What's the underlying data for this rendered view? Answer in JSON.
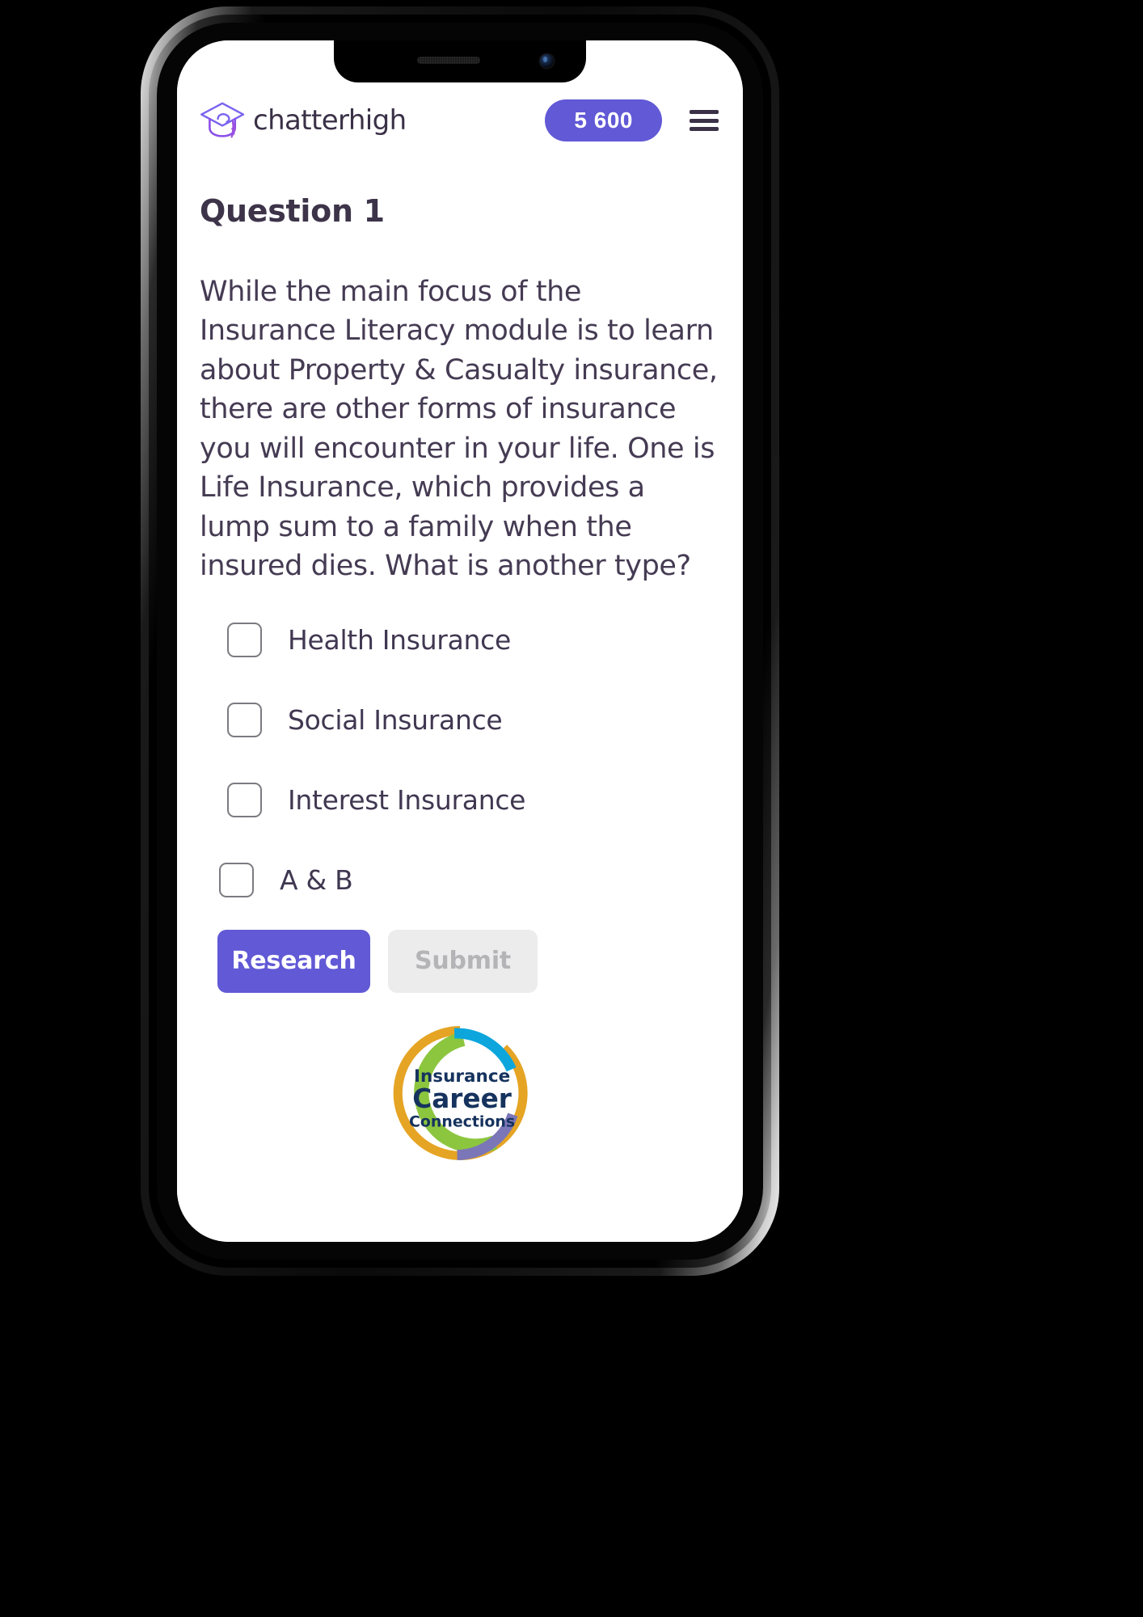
{
  "app": {
    "brand_name": "chatterhigh",
    "brand_icon": "graduation-cap-icon",
    "score": "5 600",
    "menu_icon": "hamburger-menu-icon",
    "accent_color": "#6159d6",
    "text_color": "#403751"
  },
  "question": {
    "title": "Question 1",
    "text": "While the main focus of the Insurance Literacy module is to learn about Property & Casualty insurance, there are other forms of insurance you will encounter in your life. One is Life Insurance, which provides a lump sum to a family when the insured dies. What is another type?",
    "options": [
      {
        "label": "Health Insurance",
        "checked": false
      },
      {
        "label": "Social Insurance",
        "checked": false
      },
      {
        "label": "Interest Insurance",
        "checked": false
      },
      {
        "label": "A & B",
        "checked": false
      }
    ]
  },
  "actions": {
    "research_label": "Research",
    "submit_label": "Submit",
    "submit_disabled": true
  },
  "partner_logo": {
    "name": "insurance-career-connections-logo",
    "line1": "Insurance",
    "line2": "Career",
    "line3": "Connections",
    "colors": {
      "green": "#8cc63f",
      "gold": "#e5a424",
      "blue": "#0ca6dd",
      "purple": "#7b76b8",
      "navy": "#16335e"
    }
  }
}
